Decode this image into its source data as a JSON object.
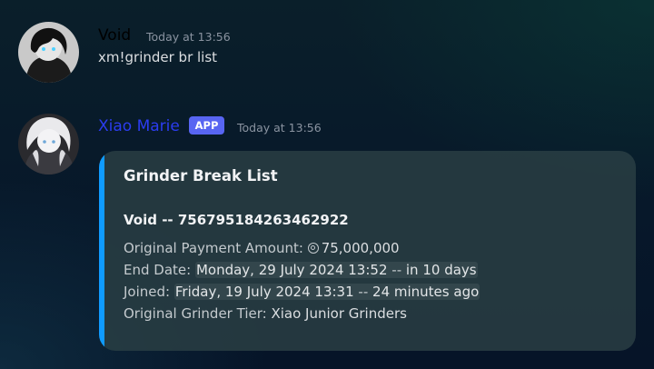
{
  "messages": [
    {
      "author": "Void",
      "author_color": "#000000",
      "timestamp": "Today at 13:56",
      "text": "xm!grinder br list",
      "avatar_icon": "user-avatar-icon"
    },
    {
      "author": "Xiao Marie",
      "author_color": "#2b3cf0",
      "badge": "APP",
      "timestamp": "Today at 13:56",
      "avatar_icon": "bot-avatar-icon",
      "embed": {
        "accent_color": "#0f9bff",
        "title": "Grinder Break List",
        "field_name": "Void -- 756795184263462922",
        "payment_label": "Original Payment Amount:",
        "payment_value": "75,000,000",
        "payment_icon": "coin-icon",
        "end_label": "End Date:",
        "end_date": "Monday, 29 July 2024 13:52",
        "end_sep": "--",
        "end_relative": "in 10 days",
        "joined_label": "Joined:",
        "joined_date": "Friday, 19 July 2024 13:31",
        "joined_sep": "--",
        "joined_relative": "24 minutes ago",
        "tier_label": "Original Grinder Tier:",
        "tier_value": "Xiao Junior Grinders"
      }
    }
  ]
}
